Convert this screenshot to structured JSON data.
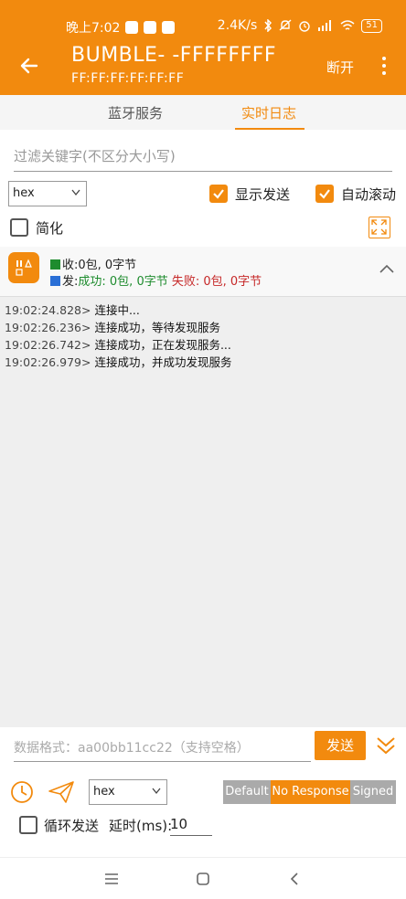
{
  "status_bar": {
    "time": "晚上7:02",
    "speed": "2.4K/s",
    "battery": "51"
  },
  "app_bar": {
    "title": "BUMBLE- -FFFFFFFF",
    "subtitle": "FF:FF:FF:FF:FF:FF",
    "disconnect_label": "断开"
  },
  "tabs": [
    {
      "label": "蓝牙服务",
      "active": false
    },
    {
      "label": "实时日志",
      "active": true
    }
  ],
  "filter": {
    "placeholder": "过滤关键字(不区分大小写)"
  },
  "format_select": {
    "value": "hex"
  },
  "options": {
    "show_sent_label": "显示发送",
    "show_sent": true,
    "auto_scroll_label": "自动滚动",
    "auto_scroll": true,
    "simplify_label": "简化",
    "simplify": false
  },
  "stats": {
    "recv_label": "收:0包, 0字节",
    "send_prefix": "发:",
    "send_success": "成功: 0包, 0字节",
    "send_fail": "失败: 0包, 0字节"
  },
  "log": [
    {
      "time": "19:02:24.828>",
      "msg": "连接中..."
    },
    {
      "time": "19:02:26.236>",
      "msg": "连接成功，等待发现服务"
    },
    {
      "time": "19:02:26.742>",
      "msg": "连接成功，正在发现服务..."
    },
    {
      "time": "19:02:26.979>",
      "msg": "连接成功，并成功发现服务"
    }
  ],
  "send_panel": {
    "input_placeholder": "数据格式：aa00bb11cc22（支持空格）",
    "send_label": "发送",
    "format_value": "hex",
    "write_modes": [
      "Default",
      "No Response",
      "Signed"
    ],
    "selected_write_mode": "No Response",
    "loop_label": "循环发送",
    "loop_enabled": false,
    "delay_label": "延时(ms):",
    "delay_value": "10"
  },
  "colors": {
    "accent": "#f28a0e",
    "success": "#1e8c2e",
    "fail": "#c62828",
    "recv_square": "#1e8c2e",
    "send_square": "#2a6fd6"
  }
}
